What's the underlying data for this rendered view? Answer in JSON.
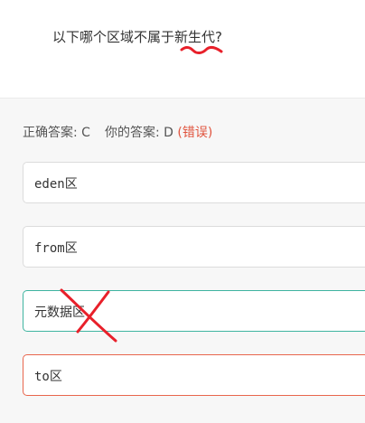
{
  "question": {
    "text": "以下哪个区域不属于新生代?"
  },
  "result": {
    "correct_label": "正确答案: C",
    "your_label": "你的答案: D",
    "status": "(错误)"
  },
  "options": [
    {
      "label": "eden区"
    },
    {
      "label": "from区"
    },
    {
      "label": "元数据区"
    },
    {
      "label": "to区"
    }
  ],
  "colors": {
    "correct_border": "#3fb4a0",
    "wrong_border": "#e8664d",
    "wrong_text": "#e0533d",
    "annotation_red": "#e8202a"
  }
}
